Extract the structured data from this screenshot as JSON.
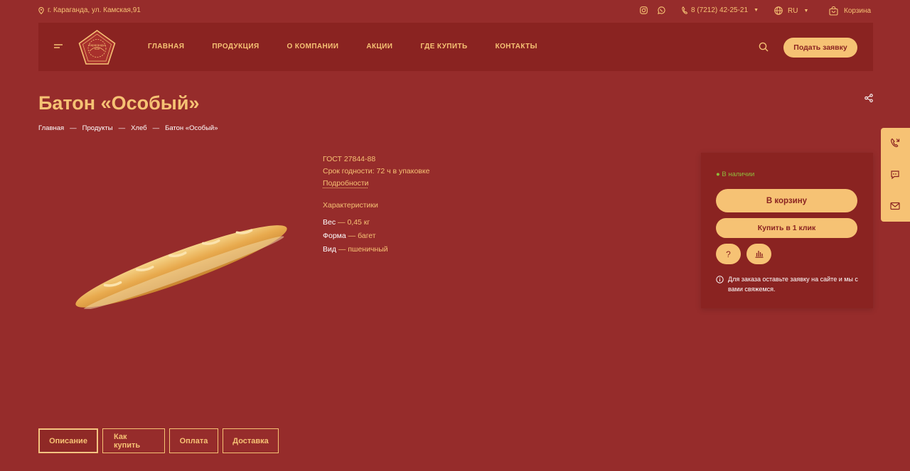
{
  "colors": {
    "background": "#962c2b",
    "header": "#8a2321",
    "accent": "#f6c274",
    "in_stock": "#8fbb3c"
  },
  "topbar": {
    "address": "г. Караганда, ул. Камская,91",
    "phone": "8 (7212) 42-25-21",
    "language": "RU",
    "cart": "Корзина",
    "icons": [
      "location-pin-icon",
      "instagram-icon",
      "whatsapp-icon",
      "phone-icon",
      "globe-icon",
      "cart-icon"
    ]
  },
  "logo": {
    "text": "Караганды нан"
  },
  "nav": [
    "ГЛАВНАЯ",
    "ПРОДУКЦИЯ",
    "О КОМПАНИИ",
    "АКЦИИ",
    "ГДЕ КУПИТЬ",
    "КОНТАКТЫ"
  ],
  "header": {
    "cta": "Подать заявку"
  },
  "product": {
    "title": "Батон «Особый»",
    "breadcrumbs": [
      "Главная",
      "Продукты",
      "Хлеб",
      "Батон «Особый»"
    ],
    "breadcrumb_separator": "—",
    "gost": "ГОСТ 27844-88",
    "shelf_life": "Срок годности: 72 ч в упаковке",
    "details_link": "Подробности",
    "characteristics_title": "Характеристики",
    "characteristics": [
      {
        "label": "Вес",
        "value": "0,45 кг"
      },
      {
        "label": "Форма",
        "value": "багет"
      },
      {
        "label": "Вид",
        "value": "пшеничный"
      }
    ],
    "value_separator": "—"
  },
  "buy_panel": {
    "stock": "В наличии",
    "add_to_cart": "В корзину",
    "one_click": "Купить в 1 клик",
    "question_label": "?",
    "note": "Для заказа оставьте заявку на сайте и мы с вами свяжемся."
  },
  "tabs": [
    "Описание",
    "Как купить",
    "Оплата",
    "Доставка"
  ],
  "active_tab": "Описание"
}
